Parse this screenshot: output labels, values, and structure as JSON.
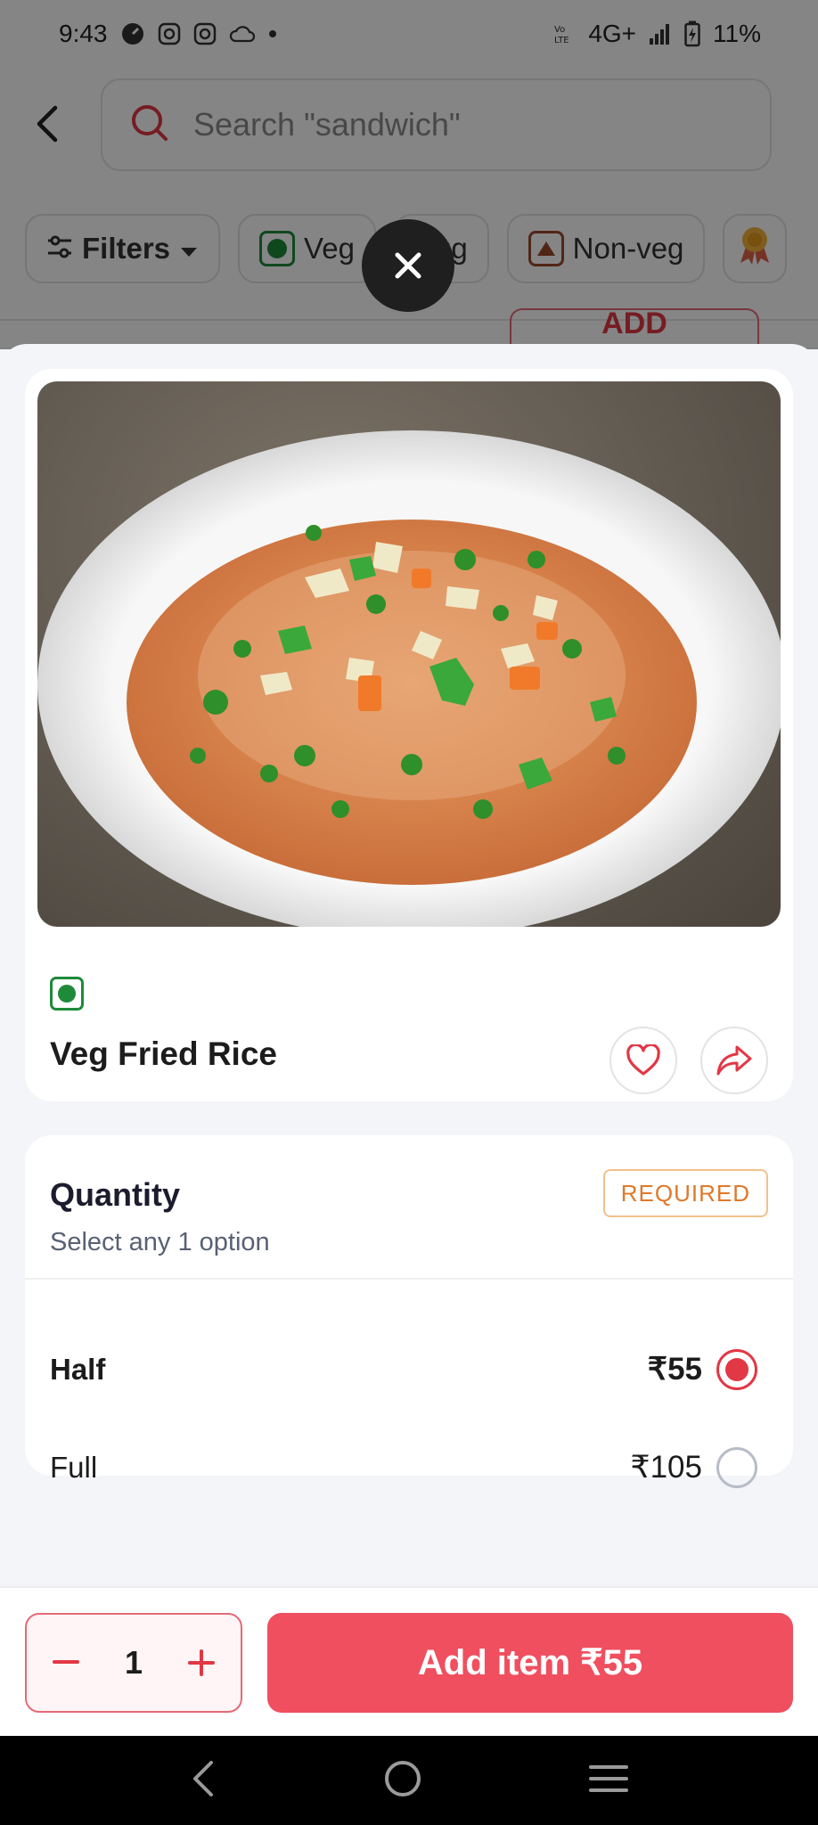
{
  "status_bar": {
    "time": "9:43",
    "network": "4G+",
    "volte": "VoLTE",
    "battery": "11%",
    "icons": [
      "speed-icon",
      "instagram-icon",
      "instagram-icon",
      "cloud-icon",
      "dot-icon",
      "volte-icon",
      "signal-icon",
      "battery-charging-icon"
    ]
  },
  "header": {
    "search_placeholder": "Search \"sandwich\""
  },
  "filters": {
    "filters_label": "Filters",
    "veg_label": "Veg",
    "egg_label": "Egg",
    "nonveg_label": "Non-veg"
  },
  "background_item": {
    "add_label": "ADD"
  },
  "item": {
    "name": "Veg Fried Rice",
    "diet": "veg"
  },
  "quantity": {
    "title": "Quantity",
    "subtitle": "Select any 1 option",
    "badge": "REQUIRED",
    "options": [
      {
        "name": "Half",
        "price": "₹55",
        "selected": true
      },
      {
        "name": "Full",
        "price": "₹105",
        "selected": false
      }
    ]
  },
  "cart": {
    "count": "1",
    "add_label": "Add item ₹55"
  },
  "colors": {
    "brand": "#ef4f5f",
    "veg": "#1f8a3a",
    "nonveg": "#9b4a2b",
    "required": "#e0782b"
  }
}
